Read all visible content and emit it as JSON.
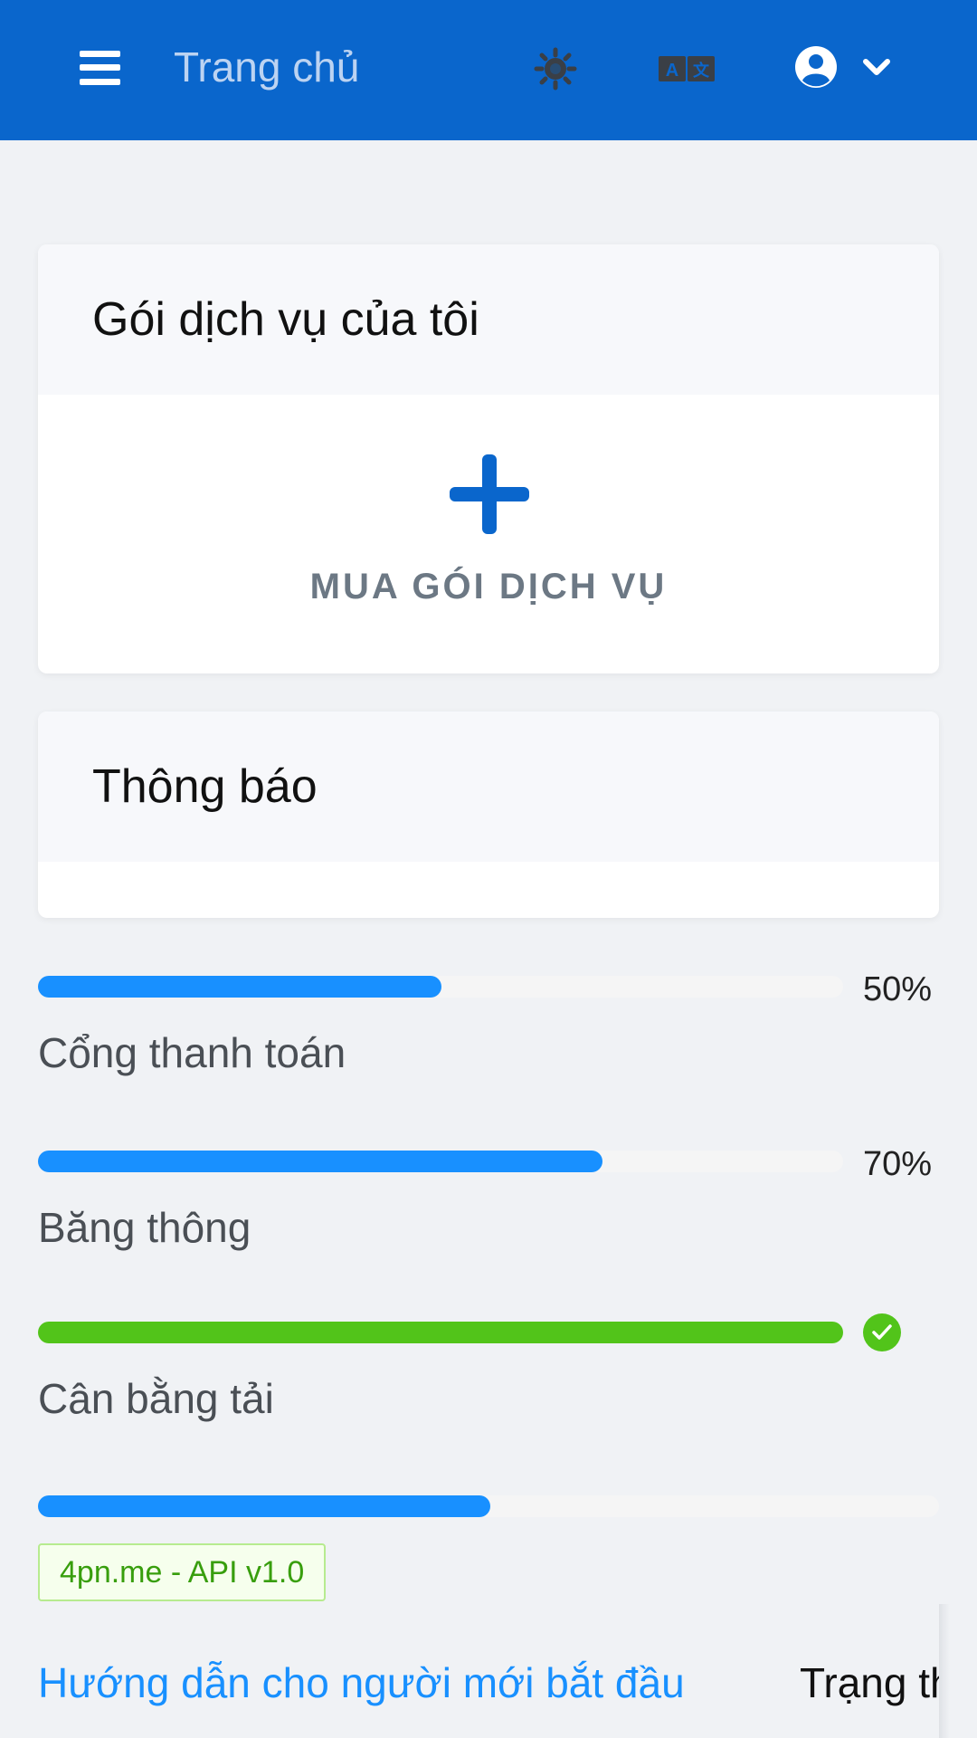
{
  "header": {
    "title": "Trang chủ",
    "bg_color": "#0a66cc",
    "icons": [
      "menu-icon",
      "sun-icon",
      "translate-icon",
      "user-circle-icon",
      "chevron-down-icon"
    ]
  },
  "cards": {
    "subscriptions": {
      "title": "Gói dịch vụ của tôi",
      "buy_label": "MUA GÓI DỊCH VỤ"
    },
    "notifications": {
      "title": "Thông báo"
    }
  },
  "progress": [
    {
      "label": "Cổng thanh toán",
      "percent_label": "50%",
      "value": 0.5,
      "color": "#1890ff"
    },
    {
      "label": "Băng thông",
      "percent_label": "70%",
      "value": 0.7,
      "color": "#1890ff"
    },
    {
      "label": "Cân bằng tải",
      "value": 1.0,
      "color": "#52c41a",
      "status": "success"
    },
    {
      "value": 0.5,
      "color": "#1890ff"
    }
  ],
  "version_tag": "4pn.me - API v1.0",
  "footer": {
    "guide_link": "Hướng dẫn cho người mới bắt đầu",
    "status_text": "Trạng thái"
  },
  "colors": {
    "primary": "#0a66cc",
    "link": "#1890ff",
    "success": "#52c41a",
    "background": "#f0f2f5"
  }
}
